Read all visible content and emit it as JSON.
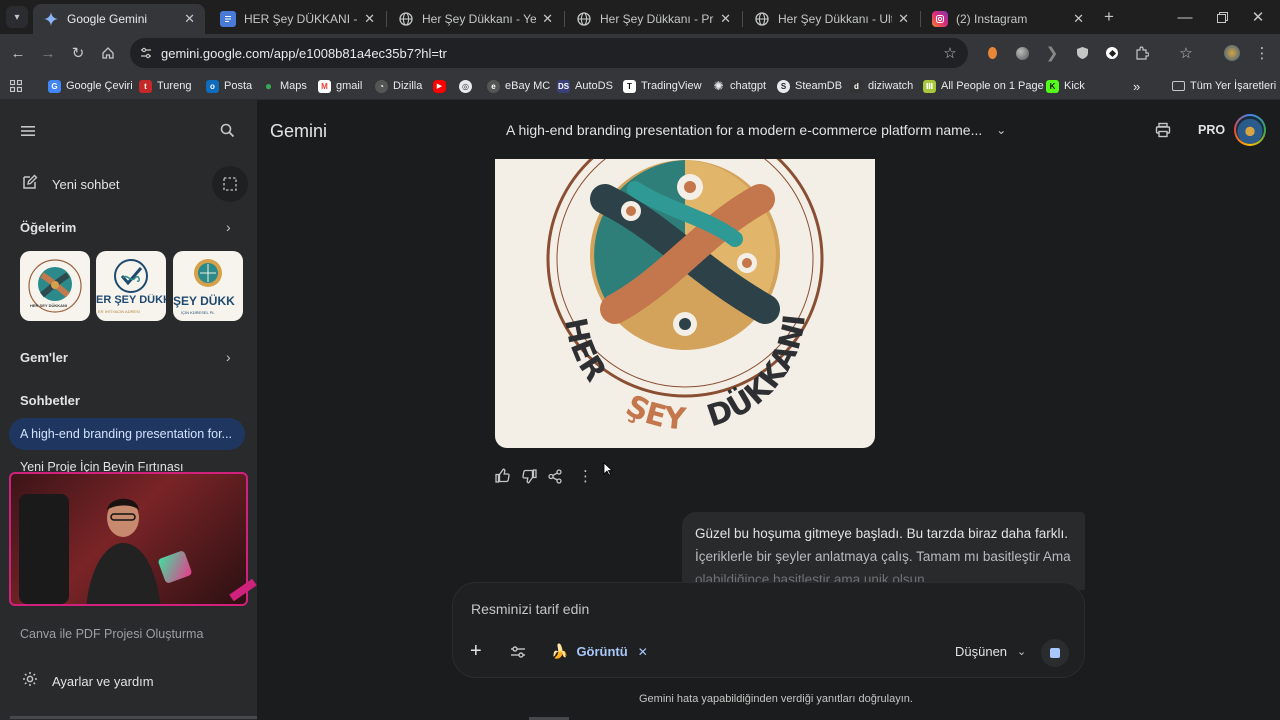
{
  "tabs": [
    {
      "title": "Google Gemini",
      "active": true,
      "icon": "gemini-icon"
    },
    {
      "title": "HER Şey DÜKKANI - Belge",
      "active": false,
      "icon": "docs-icon"
    },
    {
      "title": "Her Şey Dükkanı - Yeni Kon",
      "active": false,
      "icon": "globe-icon"
    },
    {
      "title": "Her Şey Dükkanı - Premium",
      "active": false,
      "icon": "globe-icon"
    },
    {
      "title": "Her Şey Dükkanı - Ultimat",
      "active": false,
      "icon": "globe-icon"
    },
    {
      "title": "(2) Instagram",
      "active": false,
      "icon": "instagram-icon"
    }
  ],
  "omnibox": {
    "url": "gemini.google.com/app/e1008b81a4ec35b7?hl=tr"
  },
  "bookmarks": [
    "Google Çeviri",
    "Tureng",
    "Posta",
    "Maps",
    "gmail",
    "Dizilla",
    "",
    "",
    "eBay MC",
    "AutoDS",
    "TradingView",
    "chatgpt",
    "SteamDB",
    "diziwatch",
    "All People on 1 Page",
    "Kick"
  ],
  "bookmarks_folder": "Tüm Yer İşaretleri",
  "sidebar": {
    "new_chat": "Yeni sohbet",
    "my_items": "Öğelerim",
    "gems": "Gem'ler",
    "chats": "Sohbetler",
    "chat_items": [
      "A high-end branding presentation for...",
      "Yeni Proje İçin Beyin Fırtınası",
      "Canva ile PDF Projesi Oluşturma"
    ],
    "settings": "Ayarlar ve yardım",
    "thumb_texts": [
      "HER ŞEY DÜKKANI",
      "ER ŞEY DÜKK",
      "ŞEY DÜKK"
    ],
    "thumb_subtexts": [
      "",
      "ER İHTİYACIN ADRESİ",
      "İÇİN KÜRESEL PL"
    ]
  },
  "header": {
    "app_name": "Gemini",
    "conversation_title": "A high-end branding presentation for a modern e-commerce platform name...",
    "pro_badge": "PRO"
  },
  "image_card": {
    "logo_text_top": "HER",
    "logo_text_mid": "ŞEY",
    "logo_text_end": "DÜKKANI"
  },
  "user_message": {
    "line1": "Güzel bu hoşuma gitmeye başladı. Bu tarzda biraz daha farklı.",
    "line2": "İçeriklerle bir şeyler anlatmaya çalış. Tamam mı basitleştir Ama",
    "line3": "olabildiğince basitleştir ama unik olsun."
  },
  "composer": {
    "placeholder": "Resminizi tarif edin",
    "tool_chip": "Görüntü",
    "mode": "Düşünen"
  },
  "footer_note": "Gemini hata yapabildiğinden verdiği yanıtları doğrulayın.",
  "colors": {
    "page_bg": "#1b1c1d",
    "sidebar_bg": "#282a2c",
    "active_chat_bg": "#1f3760",
    "accent_blue": "#a8c7fa",
    "webcam_border": "#d0227c"
  }
}
